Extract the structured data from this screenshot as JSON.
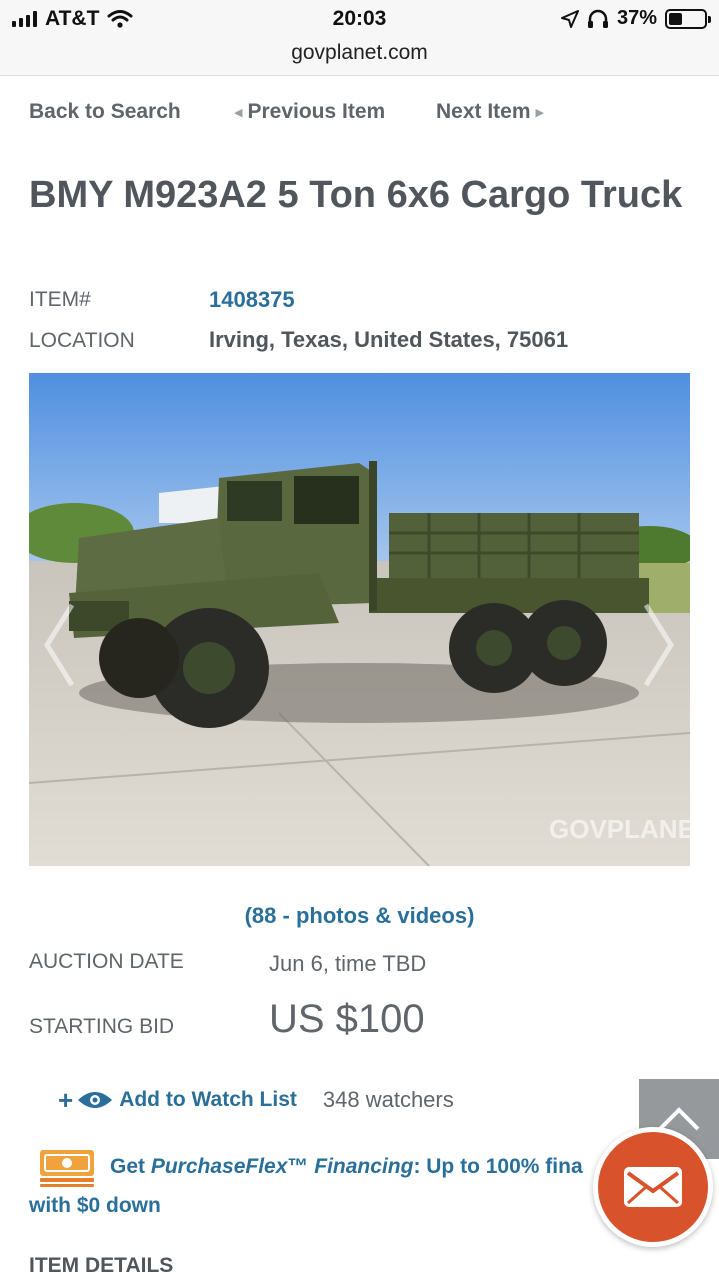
{
  "status_bar": {
    "carrier": "AT&T",
    "time": "20:03",
    "battery_percent": "37%",
    "battery_level": 0.37
  },
  "browser": {
    "url": "govplanet.com"
  },
  "nav": {
    "back": "Back to Search",
    "previous": "Previous Item",
    "next": "Next Item"
  },
  "listing": {
    "title": "BMY M923A2 5 Ton 6x6 Cargo Truck",
    "item_label": "ITEM#",
    "item_number": "1408375",
    "location_label": "LOCATION",
    "location": "Irving, Texas, United States, 75061",
    "photo_watermark": "GOVPLANET",
    "photos_link": "(88 - photos & videos)",
    "auction_date_label": "AUCTION DATE",
    "auction_date": "Jun 6, time TBD",
    "starting_bid_label": "STARTING BID",
    "starting_bid": "US $100",
    "watch_label": "Add to Watch List",
    "watchers": "348 watchers",
    "financing": {
      "prefix": "Get ",
      "brand": "PurchaseFlex",
      "tm": "™ ",
      "financing_word": "Financing",
      "suffix": ": Up to 100% fina",
      "line2": "with $0 down"
    },
    "details_heading": "ITEM DETAILS"
  },
  "colors": {
    "link_blue": "#2a6f9a",
    "text_gray": "#50565c",
    "accent_orange": "#d8532b"
  },
  "icons": [
    "signal-icon",
    "wifi-icon",
    "location-arrow-icon",
    "headphones-icon",
    "battery-icon",
    "chevron-left-icon",
    "chevron-right-icon",
    "plus-icon",
    "eye-icon",
    "money-icon",
    "chevron-up-icon",
    "envelope-icon"
  ]
}
